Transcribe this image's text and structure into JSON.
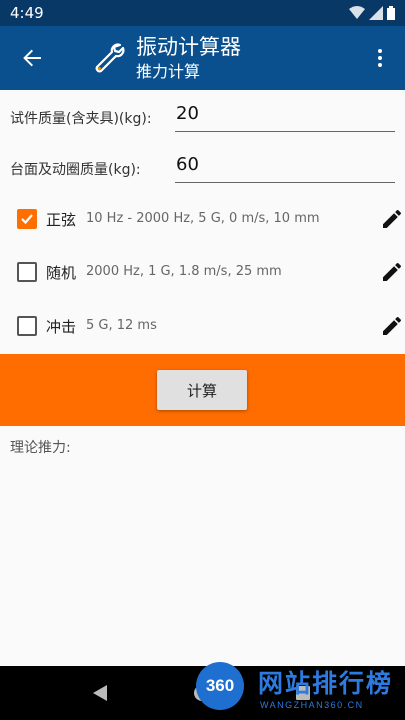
{
  "status_bar": {
    "time": "4:49"
  },
  "app_bar": {
    "title": "振动计算器",
    "subtitle": "推力计算"
  },
  "form": {
    "specimen_mass_label": "试件质量(含夹具)(kg):",
    "specimen_mass_value": "20",
    "table_mass_label": "台面及动圈质量(kg):",
    "table_mass_value": "60"
  },
  "options": [
    {
      "label": "正弦",
      "desc": "10 Hz - 2000 Hz, 5 G, 0 m/s, 10 mm",
      "checked": true
    },
    {
      "label": "随机",
      "desc": "2000 Hz, 1 G, 1.8 m/s, 25 mm",
      "checked": false
    },
    {
      "label": "冲击",
      "desc": "5 G, 12 ms",
      "checked": false
    }
  ],
  "calculate_button": "计算",
  "result": {
    "label": "理论推力:"
  },
  "watermark": {
    "badge": "360",
    "text": "网站排行榜",
    "sub": "WANGZHAN360.CN"
  },
  "colors": {
    "status_bar": "#073866",
    "app_bar": "#0a4f8e",
    "accent": "#ff6d00",
    "background": "#fafafa"
  }
}
